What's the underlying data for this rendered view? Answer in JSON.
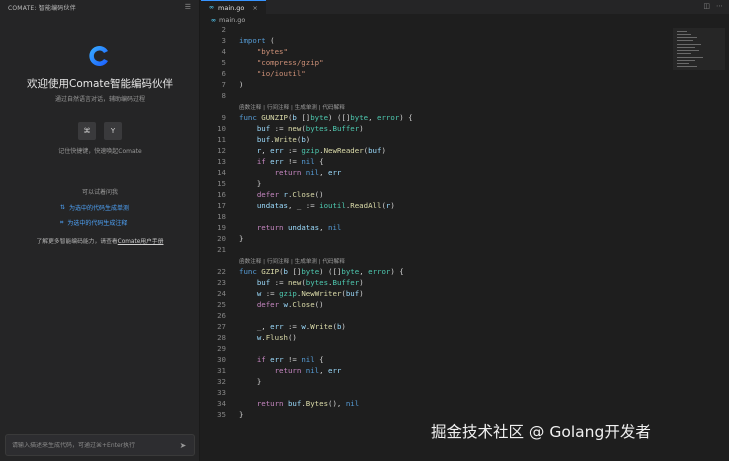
{
  "sidebar": {
    "title": "COMATE: 智能编码伙伴",
    "menu": "☰",
    "welcome_title": "欢迎使用Comate智能编码伙伴",
    "welcome_sub": "通过自然语言对话，辅助编码过程",
    "keycap_1": "⌘",
    "keycap_2": "Y",
    "shortcut_hint": "记住快捷键，快速唤起Comate",
    "try_label": "可以试着问我",
    "suggestion_1": "为选中的代码生成单测",
    "suggestion_2": "为选中的代码生成注释",
    "learn_prefix": "了解更多智能编码能力，请查看",
    "learn_link": "Comate用户手册",
    "input_placeholder": "请输入描述来生成代码，可通过⌘+Enter执行",
    "send_icon": "paper-plane-icon",
    "accent_color": "#4ea1f5"
  },
  "editor": {
    "tab_icon": "∞",
    "tab_label": "main.go",
    "tab_close": "×",
    "breadcrumb_icon": "∞",
    "breadcrumb_label": "main.go",
    "codelens_1": "函数注释 | 行间注释 | 生成单测 | 代码解释",
    "codelens_2": "函数注释 | 行间注释 | 生成单测 | 代码解释",
    "lines": [
      {
        "n": "2"
      },
      {
        "n": "3"
      },
      {
        "n": "4"
      },
      {
        "n": "5"
      },
      {
        "n": "6"
      },
      {
        "n": "7"
      },
      {
        "n": "8"
      },
      {
        "n": "9"
      },
      {
        "n": "10"
      },
      {
        "n": "11"
      },
      {
        "n": "12"
      },
      {
        "n": "13"
      },
      {
        "n": "14"
      },
      {
        "n": "15"
      },
      {
        "n": "16"
      },
      {
        "n": "17"
      },
      {
        "n": "18"
      },
      {
        "n": "19"
      },
      {
        "n": "20"
      },
      {
        "n": "21"
      },
      {
        "n": "22"
      },
      {
        "n": "23"
      },
      {
        "n": "24"
      },
      {
        "n": "25"
      },
      {
        "n": "26"
      },
      {
        "n": "27"
      },
      {
        "n": "28"
      },
      {
        "n": "29"
      },
      {
        "n": "30"
      },
      {
        "n": "31"
      },
      {
        "n": "32"
      },
      {
        "n": "33"
      },
      {
        "n": "34"
      },
      {
        "n": "35"
      }
    ]
  },
  "watermark": "掘金技术社区 @ Golang开发者"
}
